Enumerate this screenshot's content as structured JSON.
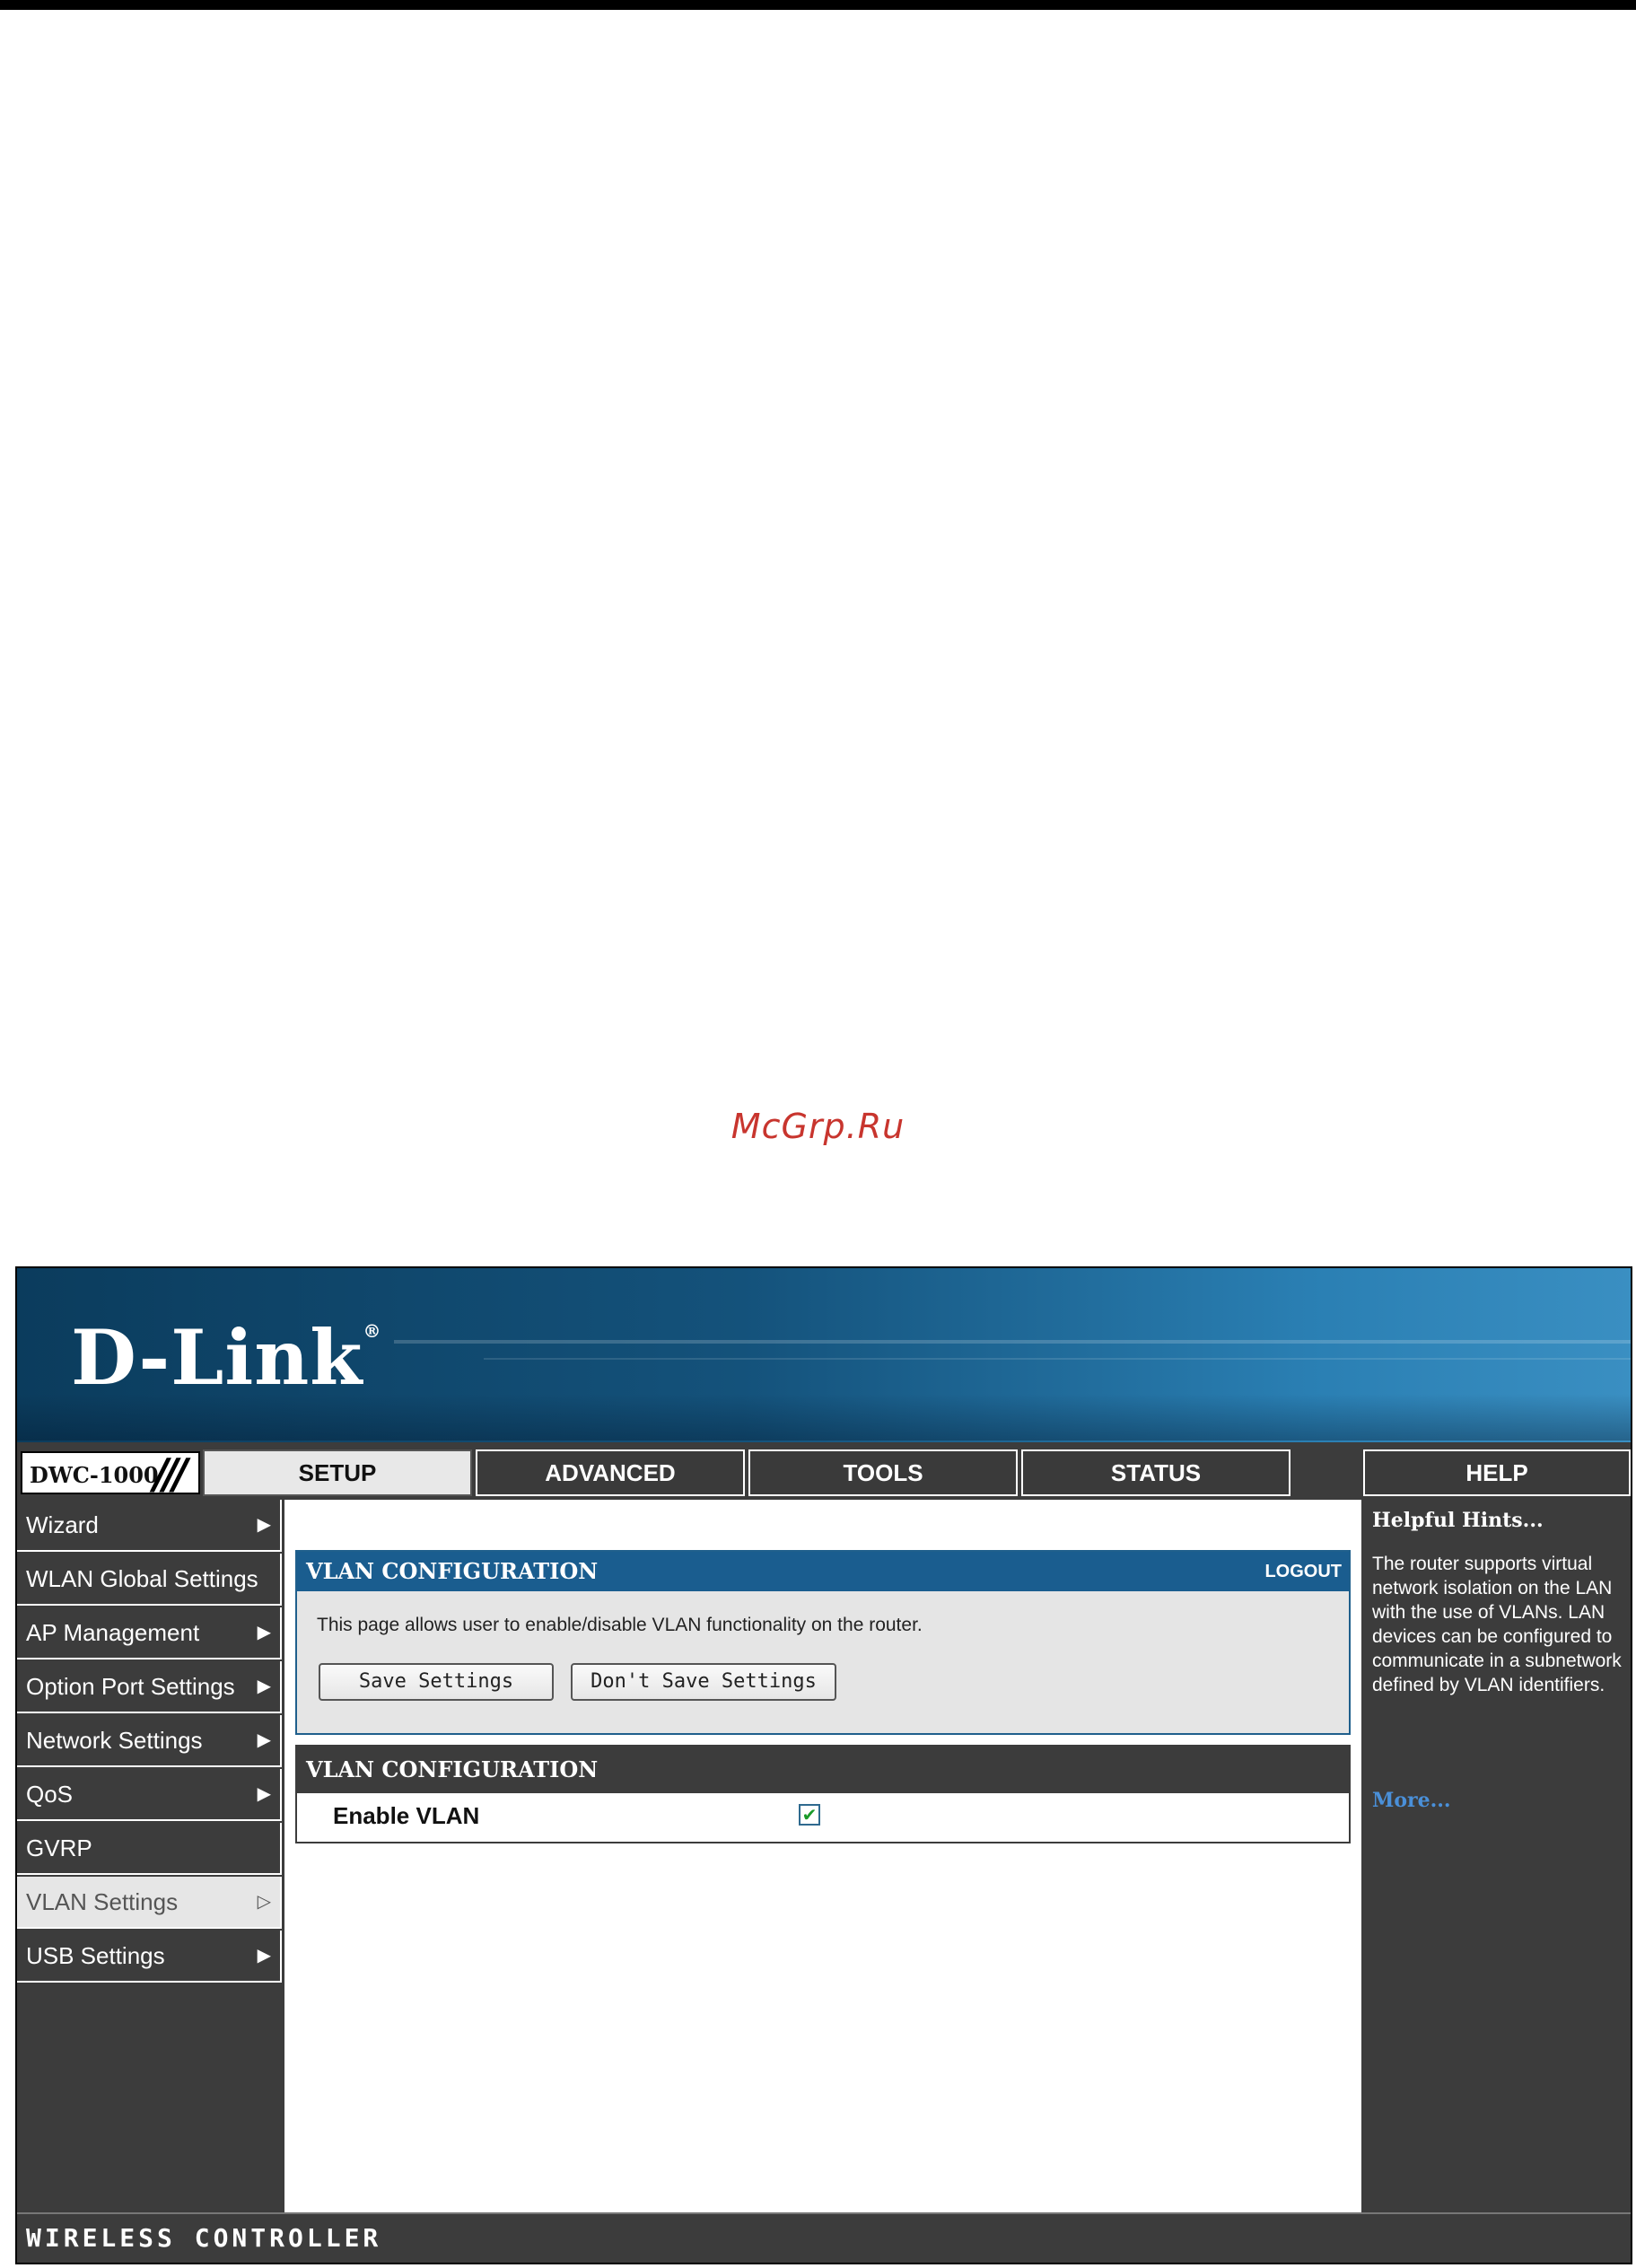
{
  "watermark": "McGrp.Ru",
  "brand": {
    "logo": "D-Link",
    "registered": "®"
  },
  "model": {
    "label": "DWC-1000",
    "slashes": "///"
  },
  "tabs": [
    {
      "label": "SETUP",
      "active": true
    },
    {
      "label": "ADVANCED"
    },
    {
      "label": "TOOLS"
    },
    {
      "label": "STATUS"
    },
    {
      "label": "HELP"
    }
  ],
  "sidebar": {
    "items": [
      {
        "label": "Wizard",
        "arrow": "▶"
      },
      {
        "label": "WLAN Global Settings",
        "arrow": ""
      },
      {
        "label": "AP Management",
        "arrow": "▶"
      },
      {
        "label": "Option Port Settings",
        "arrow": "▶"
      },
      {
        "label": "Network Settings",
        "arrow": "▶"
      },
      {
        "label": "QoS",
        "arrow": "▶"
      },
      {
        "label": "GVRP",
        "arrow": ""
      },
      {
        "label": "VLAN Settings",
        "arrow": "▷",
        "active": true
      },
      {
        "label": "USB Settings",
        "arrow": "▶"
      }
    ]
  },
  "main": {
    "panel1": {
      "title": "VLAN CONFIGURATION",
      "logout": "LOGOUT",
      "description": "This page allows user to enable/disable VLAN functionality on the router.",
      "save_label": "Save Settings",
      "dont_save_label": "Don't Save Settings"
    },
    "panel2": {
      "title": "VLAN CONFIGURATION",
      "field_label": "Enable VLAN",
      "enable_vlan_checked": true,
      "check_glyph": "✔"
    }
  },
  "help": {
    "title": "Helpful Hints...",
    "body": "The router supports virtual network isolation on the LAN with the use of VLANs. LAN devices can be configured to communicate in a subnetwork defined by VLAN identifiers.",
    "more": "More..."
  },
  "footer": {
    "label": "WIRELESS CONTROLLER"
  },
  "colors": {
    "banner": "#14527b",
    "panel_header": "#1a5d8f",
    "dark_bg": "#3c3c3c",
    "watermark": "#c8352e",
    "more_link": "#4a90d9"
  }
}
